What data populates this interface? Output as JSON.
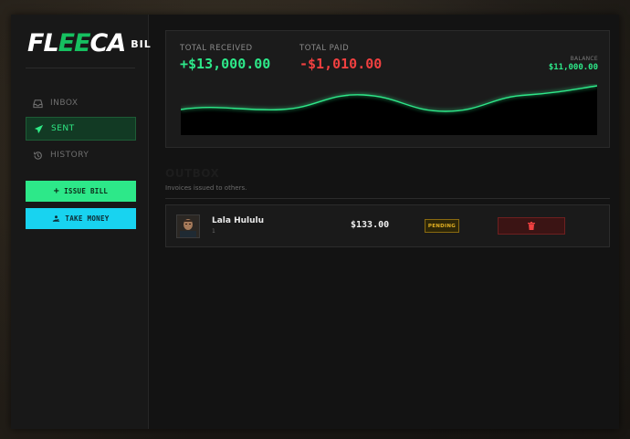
{
  "app": {
    "logo_part1": "FL",
    "logo_part2": "EE",
    "logo_part3": "CA",
    "logo_suffix": "BIL"
  },
  "sidebar": {
    "items": [
      {
        "label": "INBOX",
        "icon": "inbox-icon",
        "active": false
      },
      {
        "label": "SENT",
        "icon": "paper-plane-icon",
        "active": true
      },
      {
        "label": "HISTORY",
        "icon": "history-icon",
        "active": false
      }
    ],
    "issue_bill_label": "ISSUE BILL",
    "take_money_label": "TAKE MONEY"
  },
  "stats": {
    "total_received_label": "TOTAL RECEIVED",
    "total_received_value": "+$13,000.00",
    "total_paid_label": "TOTAL PAID",
    "total_paid_value": "-$1,010.00",
    "balance_label": "BALANCE",
    "balance_value": "$11,000.00"
  },
  "outbox": {
    "title": "OUTBOX",
    "subtitle": "Invoices issued to others.",
    "rows": [
      {
        "name": "Lala Hululu",
        "id": "1",
        "amount": "$133.00",
        "status": "PENDING"
      }
    ]
  },
  "colors": {
    "accent_green": "#2de889",
    "accent_cyan": "#18d3f0",
    "negative_red": "#f04040",
    "pending_yellow": "#e3b122"
  }
}
